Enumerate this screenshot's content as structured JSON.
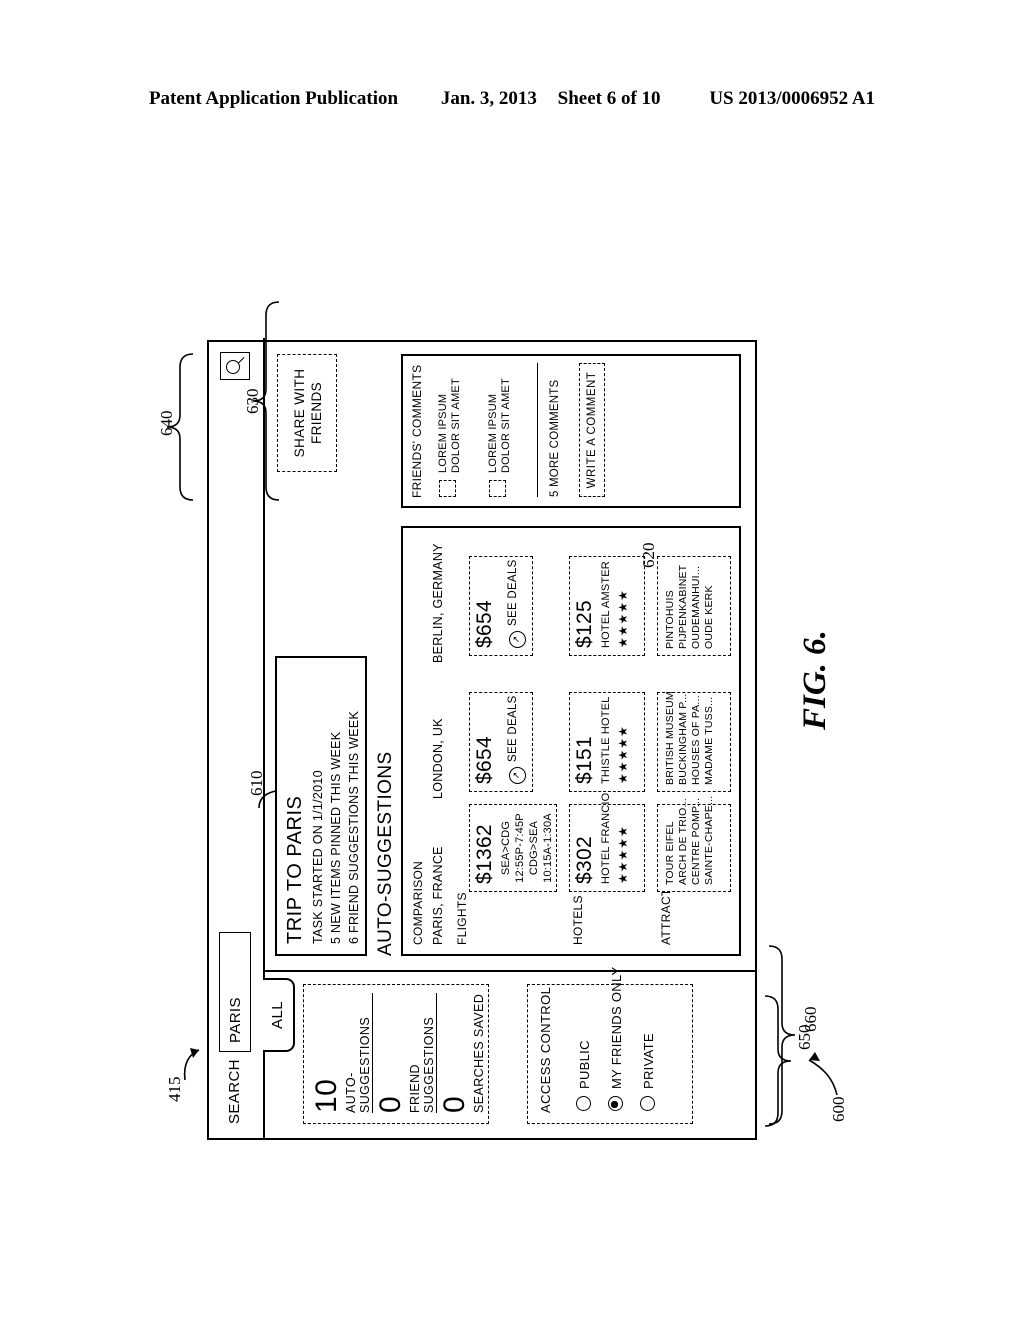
{
  "page_header": {
    "publication": "Patent Application Publication",
    "date": "Jan. 3, 2013",
    "sheet": "Sheet 6 of 10",
    "number": "US 2013/0006952 A1"
  },
  "figure": {
    "caption": "FIG. 6.",
    "ref_main": "600",
    "ref_search": "415",
    "ref_counts": "660",
    "ref_access": "650",
    "ref_compare": "610",
    "ref_comments": "630",
    "ref_write": "620",
    "ref_share": "640"
  },
  "search_bar": {
    "label": "SEARCH",
    "value": "PARIS",
    "icon": "search-icon",
    "tab": "ALL"
  },
  "counts_panel": {
    "items": [
      {
        "number": "10",
        "caption": "AUTO- SUGGESTIONS"
      },
      {
        "number": "0",
        "caption": "FRIEND SUGGESTIONS"
      },
      {
        "number": "0",
        "caption": "SEARCHES SAVED"
      }
    ]
  },
  "access_control": {
    "title": "ACCESS CONTROL",
    "options": [
      {
        "label": "PUBLIC",
        "selected": false
      },
      {
        "label": "MY FRIENDS ONLY",
        "selected": true
      },
      {
        "label": "PRIVATE",
        "selected": false
      }
    ]
  },
  "trip_panel": {
    "title": "TRIP TO PARIS",
    "lines": [
      "TASK STARTED ON 1/1/2010",
      "5 NEW ITEMS PINNED THIS WEEK",
      "6 FRIEND SUGGESTIONS THIS WEEK"
    ]
  },
  "share_button": {
    "line1": "SHARE WITH",
    "line2": "FRIENDS"
  },
  "auto_suggestions": {
    "heading": "AUTO-SUGGESTIONS",
    "comparison_label": "COMPARISON",
    "cities": [
      "PARIS, FRANCE",
      "LONDON, UK",
      "BERLIN, GERMANY"
    ],
    "rows": [
      {
        "label": "FLIGHTS"
      },
      {
        "label": "HOTELS"
      },
      {
        "label": "ATTRACTIONS"
      }
    ],
    "flights": [
      {
        "price": "$1362",
        "legs": [
          "SEA>CDG",
          "12:55P-7:45P",
          "CDG>SEA",
          "10:15A-1:30A"
        ],
        "deal_label": "",
        "deal_glyph": ""
      },
      {
        "price": "$654",
        "legs": [],
        "deal_label": "SEE DEALS",
        "deal_glyph": "deal-icon"
      },
      {
        "price": "$654",
        "legs": [],
        "deal_label": "SEE DEALS",
        "deal_glyph": "deal-icon"
      }
    ],
    "hotels": [
      {
        "price": "$302",
        "name": "HOTEL FRANCIO",
        "stars": "★★★★★"
      },
      {
        "price": "$151",
        "name": "THISTLE HOTEL",
        "stars": "★★★★★"
      },
      {
        "price": "$125",
        "name": "HOTEL AMSTER",
        "stars": "★★★★★"
      }
    ],
    "attractions": [
      [
        "TOUR EIFEL",
        "ARCH DE TRIO...",
        "CENTRE POMP...",
        "SAINTE-CHAPE..."
      ],
      [
        "BRITISH MUSEUM",
        "BUCKINGHAM P...",
        "HOUSES OF PA...",
        "MADAME TUSS..."
      ],
      [
        "PINTOHUIS",
        "PIJPENKABINET",
        "OUDEMANHUI...",
        "OUDE KERK"
      ]
    ]
  },
  "friends_comments": {
    "title": "FRIENDS' COMMENTS",
    "comments": [
      {
        "line1": "LOREM IPSUM",
        "line2": "DOLOR SIT AMET"
      },
      {
        "line1": "LOREM IPSUM",
        "line2": "DOLOR SIT AMET"
      }
    ],
    "more": "5 MORE COMMENTS",
    "write_button": "WRITE A COMMENT"
  }
}
